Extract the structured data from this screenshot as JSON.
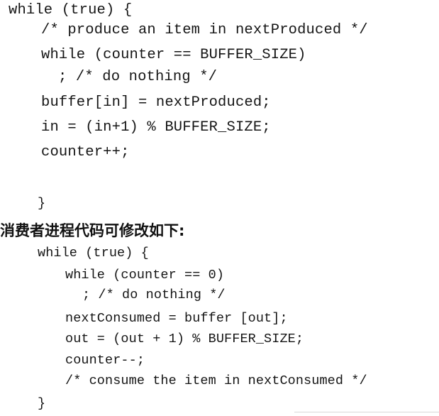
{
  "producer": {
    "lines": [
      "while (true) {",
      "/* produce an item in nextProduced */",
      "while (counter == BUFFER_SIZE)",
      "; /* do nothing */",
      "buffer[in] = nextProduced;",
      "in = (in+1) % BUFFER_SIZE;",
      "counter++;",
      "}"
    ]
  },
  "consumer_heading": "消费者进程代码可修改如下:",
  "consumer": {
    "lines": [
      "while (true) {",
      "while (counter == 0)",
      "; /* do nothing */",
      "nextConsumed = buffer [out];",
      "out = (out + 1) % BUFFER_SIZE;",
      "counter--;",
      "/* consume the item in nextConsumed */",
      "}"
    ]
  }
}
